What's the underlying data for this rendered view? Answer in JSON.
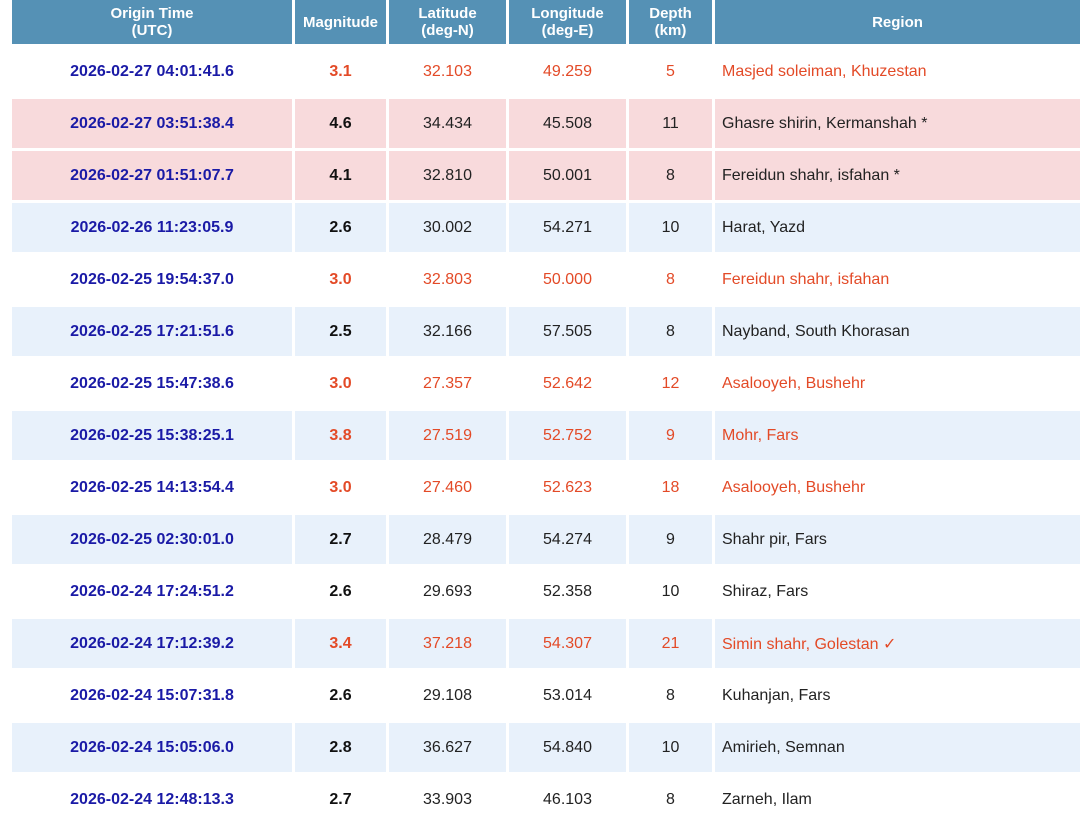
{
  "table": {
    "headers": {
      "time": "Origin Time",
      "time_sub": "(UTC)",
      "magnitude": "Magnitude",
      "latitude": "Latitude",
      "latitude_sub": "(deg-N)",
      "longitude": "Longitude",
      "longitude_sub": "(deg-E)",
      "depth": "Depth",
      "depth_sub": "(km)",
      "region": "Region"
    },
    "rows": [
      {
        "time": "2026-02-27 04:01:41.6",
        "mag": "3.1",
        "lat": "32.103",
        "lon": "49.259",
        "depth": "5",
        "region": "Masjed soleiman, Khuzestan"
      },
      {
        "time": "2026-02-27 03:51:38.4",
        "mag": "4.6",
        "lat": "34.434",
        "lon": "45.508",
        "depth": "11",
        "region": "Ghasre shirin, Kermanshah *"
      },
      {
        "time": "2026-02-27 01:51:07.7",
        "mag": "4.1",
        "lat": "32.810",
        "lon": "50.001",
        "depth": "8",
        "region": "Fereidun shahr, isfahan *"
      },
      {
        "time": "2026-02-26 11:23:05.9",
        "mag": "2.6",
        "lat": "30.002",
        "lon": "54.271",
        "depth": "10",
        "region": "Harat, Yazd"
      },
      {
        "time": "2026-02-25 19:54:37.0",
        "mag": "3.0",
        "lat": "32.803",
        "lon": "50.000",
        "depth": "8",
        "region": "Fereidun shahr, isfahan"
      },
      {
        "time": "2026-02-25 17:21:51.6",
        "mag": "2.5",
        "lat": "32.166",
        "lon": "57.505",
        "depth": "8",
        "region": "Nayband, South Khorasan"
      },
      {
        "time": "2026-02-25 15:47:38.6",
        "mag": "3.0",
        "lat": "27.357",
        "lon": "52.642",
        "depth": "12",
        "region": "Asalooyeh, Bushehr"
      },
      {
        "time": "2026-02-25 15:38:25.1",
        "mag": "3.8",
        "lat": "27.519",
        "lon": "52.752",
        "depth": "9",
        "region": "Mohr, Fars"
      },
      {
        "time": "2026-02-25 14:13:54.4",
        "mag": "3.0",
        "lat": "27.460",
        "lon": "52.623",
        "depth": "18",
        "region": "Asalooyeh, Bushehr"
      },
      {
        "time": "2026-02-25 02:30:01.0",
        "mag": "2.7",
        "lat": "28.479",
        "lon": "54.274",
        "depth": "9",
        "region": "Shahr pir, Fars"
      },
      {
        "time": "2026-02-24 17:24:51.2",
        "mag": "2.6",
        "lat": "29.693",
        "lon": "52.358",
        "depth": "10",
        "region": "Shiraz, Fars"
      },
      {
        "time": "2026-02-24 17:12:39.2",
        "mag": "3.4",
        "lat": "37.218",
        "lon": "54.307",
        "depth": "21",
        "region": "Simin shahr, Golestan ✓"
      },
      {
        "time": "2026-02-24 15:07:31.8",
        "mag": "2.6",
        "lat": "29.108",
        "lon": "53.014",
        "depth": "8",
        "region": "Kuhanjan, Fars"
      },
      {
        "time": "2026-02-24 15:05:06.0",
        "mag": "2.8",
        "lat": "36.627",
        "lon": "54.840",
        "depth": "10",
        "region": "Amirieh, Semnan"
      },
      {
        "time": "2026-02-24 12:48:13.3",
        "mag": "2.7",
        "lat": "33.903",
        "lon": "46.103",
        "depth": "8",
        "region": "Zarneh, Ilam"
      }
    ]
  },
  "colors": {
    "header_bg": "#5591b5",
    "time_text": "#1a1aa6",
    "highlight_text": "#e34a27",
    "row_pink": "#f8dadc",
    "row_blue": "#e8f1fb"
  }
}
